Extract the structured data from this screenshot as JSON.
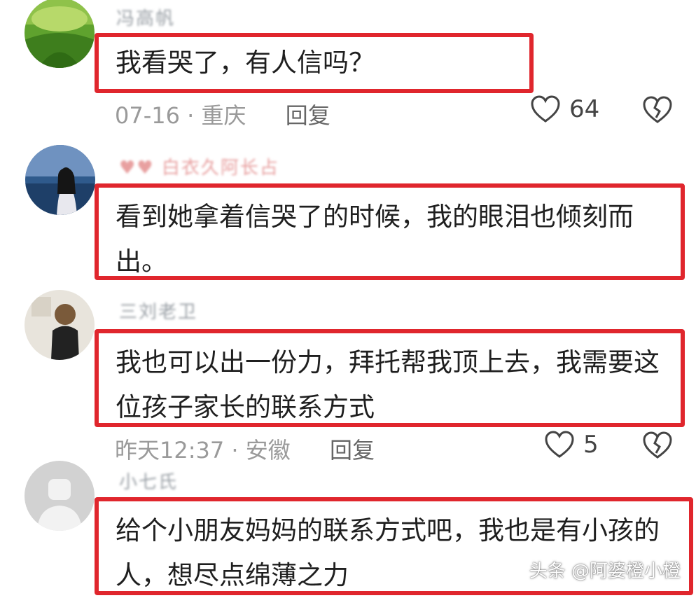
{
  "comments": [
    {
      "username": "冯高帆",
      "text": "我看哭了，有人信吗？",
      "date": "07-16",
      "location": "重庆",
      "reply_label": "回复",
      "likes": "64",
      "avatar_icon": "green-landscape-avatar"
    },
    {
      "username": "♥♥ 白衣久阿长占",
      "text": "看到她拿着信哭了的时候，我的眼泪也倾刻而出。",
      "avatar_icon": "girl-seaside-avatar"
    },
    {
      "username": "三刘老卫",
      "text": "我也可以出一份力，拜托帮我顶上去，我需要这位孩子家长的联系方式",
      "date": "昨天12:37",
      "location": "安徽",
      "reply_label": "回复",
      "likes": "5",
      "avatar_icon": "person-avatar"
    },
    {
      "username": "小七氏",
      "text": "给个小朋友妈妈的联系方式吧，我也是有小孩的人，想尽点绵薄之力",
      "avatar_icon": "default-gray-avatar"
    }
  ],
  "separator": " · ",
  "watermark": "头条 @阿婆橙小橙",
  "colors": {
    "highlight_border": "#e0262d",
    "meta_text": "#9a9a9a"
  }
}
